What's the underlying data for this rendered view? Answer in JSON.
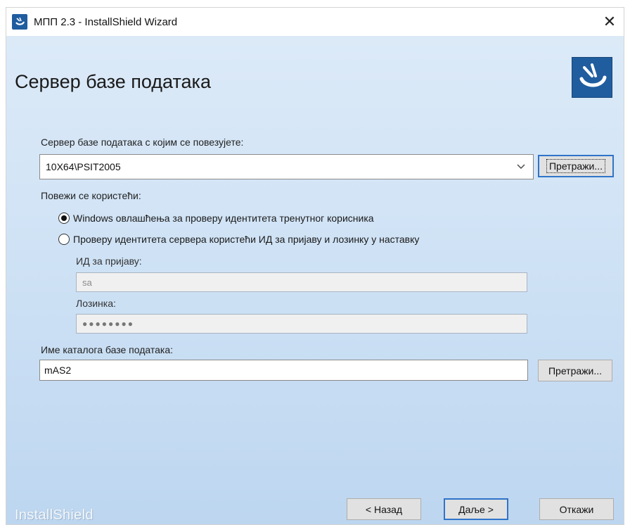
{
  "window": {
    "title": "МПП 2.3 - InstallShield Wizard",
    "close_glyph": "✕"
  },
  "header": {
    "title": "Сервер базе података"
  },
  "server": {
    "label": "Сервер базе података с којим се повезујете:",
    "value": "10X64\\PSIT2005",
    "browse_label": "Претражи..."
  },
  "auth": {
    "label": "Повежи се користећи:",
    "options": [
      {
        "label": "Windows овлашћења за проверу идентитета тренутног корисника",
        "selected": true
      },
      {
        "label": "Проверу идентитета сервера користећи ИД за пријаву и лозинку у наставку",
        "selected": false
      }
    ],
    "login_label": "ИД за пријаву:",
    "login_value": "sa",
    "password_label": "Лозинка:",
    "password_value": "●●●●●●●●"
  },
  "catalog": {
    "label": "Име каталога базе података:",
    "value": "mAS2",
    "browse_label": "Претражи..."
  },
  "footer": {
    "brand": "InstallShield",
    "back_label": "< Назад",
    "next_label": "Даље >",
    "cancel_label": "Откажи"
  },
  "colors": {
    "accent": "#2f74c9",
    "logo_bg": "#1f5d9f",
    "panel_bg": "#cfe2f5"
  },
  "icons": {
    "app": "installshield-icon",
    "close": "close-icon",
    "dropdown": "chevron-down-icon"
  }
}
